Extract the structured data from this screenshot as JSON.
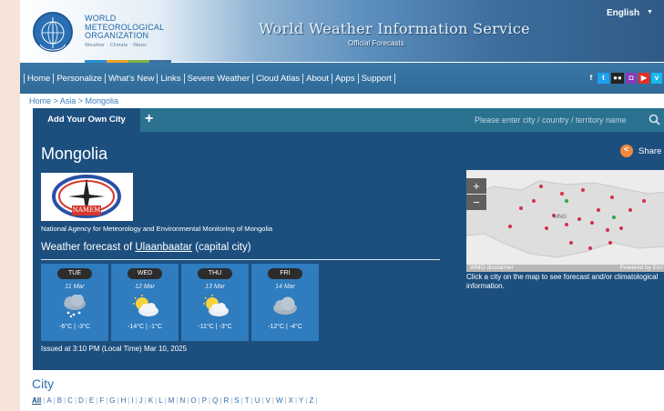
{
  "header": {
    "org_line1": "WORLD",
    "org_line2": "METEOROLOGICAL",
    "org_line3": "ORGANIZATION",
    "org_tagline": "Weather · Climate · Water",
    "service_title": "World Weather Information Service",
    "service_subtitle": "Official Forecasts",
    "language": "English",
    "brand_colors": [
      "#2b8fd1",
      "#f0a12a",
      "#7cb342",
      "#3d6f9f"
    ]
  },
  "nav": {
    "items": [
      "Home",
      "Personalize",
      "What's New",
      "Links",
      "Severe Weather",
      "Cloud Atlas",
      "About",
      "Apps",
      "Support"
    ],
    "social_icons": [
      "facebook-icon",
      "twitter-icon",
      "flickr-icon",
      "instagram-icon",
      "youtube-icon",
      "vimeo-icon"
    ]
  },
  "breadcrumb": "Home > Asia > Mongolia",
  "tabs": {
    "active": "Add Your Own City",
    "add_symbol": "+"
  },
  "search": {
    "placeholder": "Please enter city / country / territory name"
  },
  "country": {
    "title": "Mongolia",
    "share_label": "Share",
    "logo_text": "NAMEM",
    "agency": "National Agency for Meteorology and Environmental Monitoring of Mongolia"
  },
  "forecast": {
    "heading_prefix": "Weather forecast of ",
    "city": "Ulaanbaatar",
    "heading_suffix": " (capital city)",
    "days": [
      {
        "day": "TUE",
        "date": "11 Mar",
        "icon": "cloud-snow-icon",
        "temp": "-6°C | -3°C"
      },
      {
        "day": "WED",
        "date": "12 Mar",
        "icon": "partly-cloudy-icon",
        "temp": "-14°C | -1°C"
      },
      {
        "day": "THU",
        "date": "13 Mar",
        "icon": "partly-cloudy-icon",
        "temp": "-11°C | -3°C"
      },
      {
        "day": "FRI",
        "date": "14 Mar",
        "icon": "cloudy-icon",
        "temp": "-12°C | -4°C"
      }
    ],
    "issued": "Issued at 3:10 PM (Local Time) Mar 10, 2025"
  },
  "map": {
    "zoom_in": "+",
    "zoom_out": "−",
    "disclaimer": "WMO disclaimer",
    "credit": "Powered by Esri",
    "hint": "Click a city on the map to see forecast and/or climatological information.",
    "label": "MNG"
  },
  "city_section": {
    "title": "City",
    "letters": [
      "All",
      "A",
      "B",
      "C",
      "D",
      "E",
      "F",
      "G",
      "H",
      "I",
      "J",
      "K",
      "L",
      "M",
      "N",
      "O",
      "P",
      "Q",
      "R",
      "S",
      "T",
      "U",
      "V",
      "W",
      "X",
      "Y",
      "Z"
    ]
  }
}
